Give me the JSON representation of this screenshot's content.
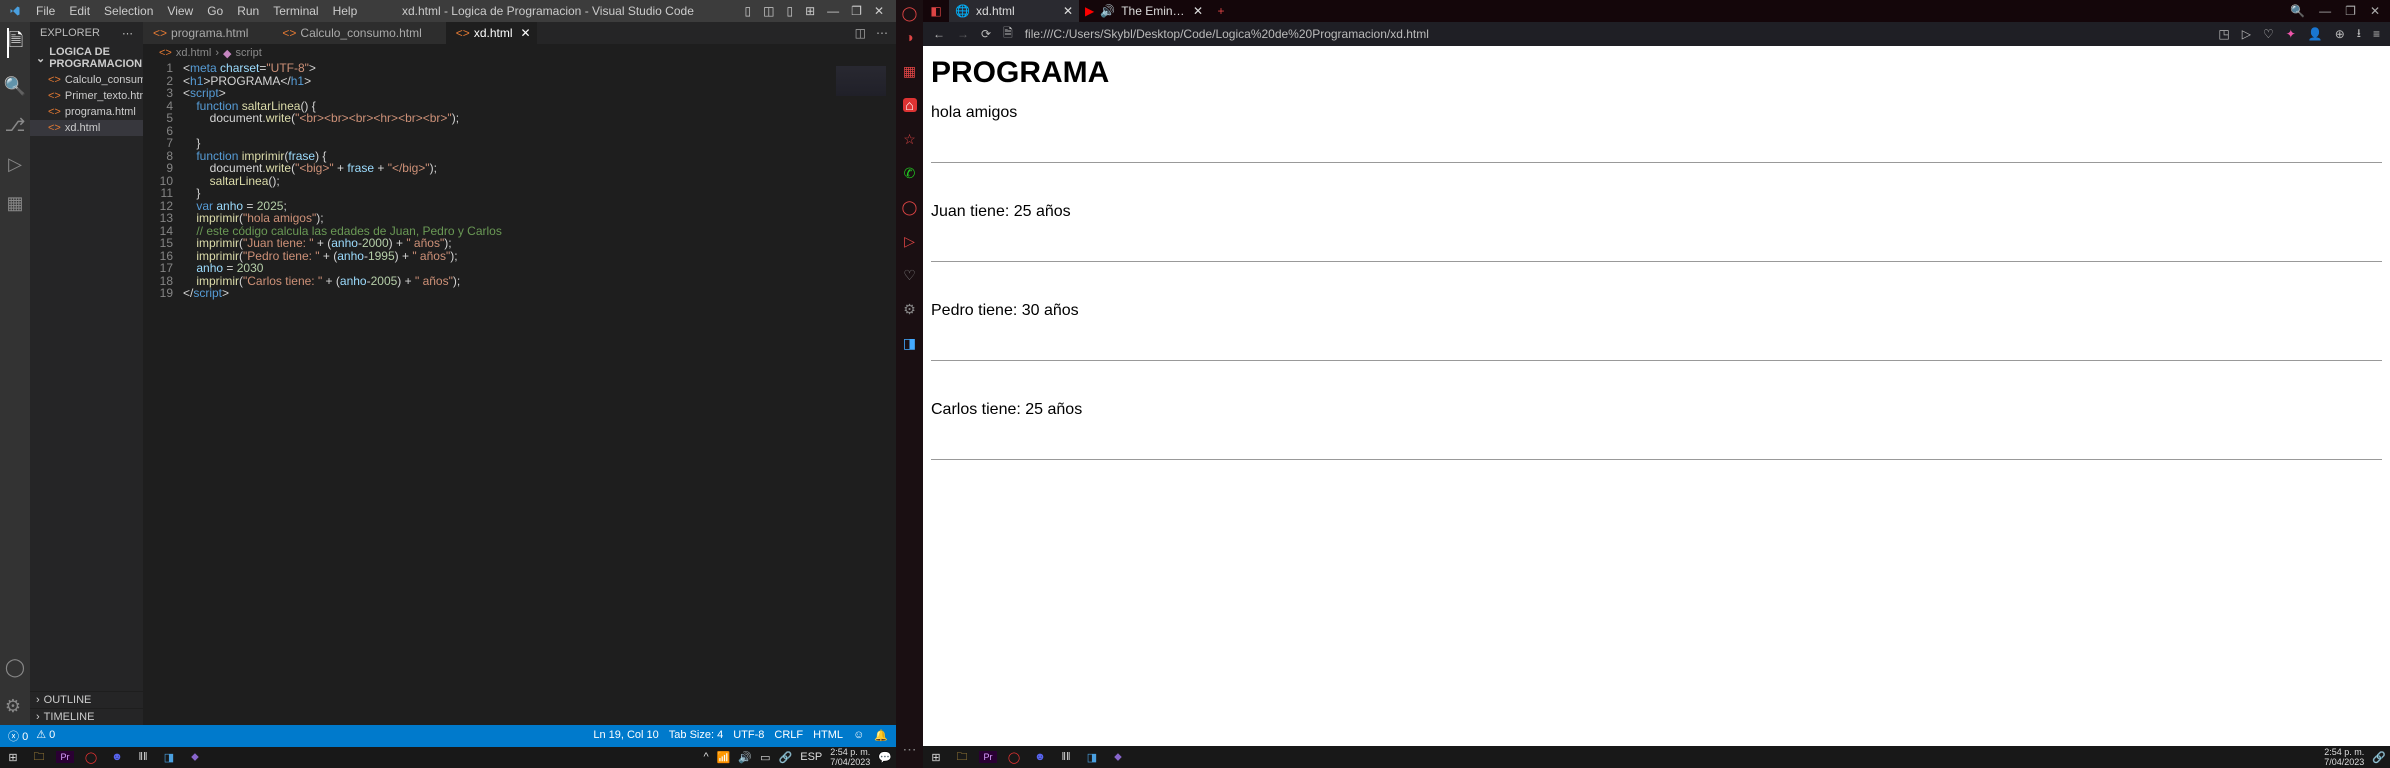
{
  "vscode": {
    "menu": [
      "File",
      "Edit",
      "Selection",
      "View",
      "Go",
      "Run",
      "Terminal",
      "Help"
    ],
    "title": "xd.html - Logica de Programacion - Visual Studio Code",
    "explorer_label": "EXPLORER",
    "folder_name": "LOGICA DE PROGRAMACION",
    "files": [
      {
        "name": "Calculo_consumo.html"
      },
      {
        "name": "Primer_texto.html"
      },
      {
        "name": "programa.html"
      },
      {
        "name": "xd.html"
      }
    ],
    "outline_label": "OUTLINE",
    "timeline_label": "TIMELINE",
    "tabs": [
      {
        "label": "programa.html",
        "active": false
      },
      {
        "label": "Calculo_consumo.html",
        "active": false
      },
      {
        "label": "xd.html",
        "active": true
      }
    ],
    "breadcrumb": [
      "xd.html",
      "script"
    ],
    "statusbar": {
      "errors": "0",
      "warnings": "0",
      "ln_col": "Ln 19, Col 10",
      "tab_size": "Tab Size: 4",
      "encoding": "UTF-8",
      "eol": "CRLF",
      "language": "HTML"
    },
    "code_lines": 19
  },
  "code": {
    "l1": {
      "a": "<",
      "b": "meta",
      "c": " charset",
      "d": "=",
      "e": "\"UTF-8\"",
      "f": ">"
    },
    "l2": {
      "a": "<",
      "b": "h1",
      "c": ">",
      "d": "PROGRAMA",
      "e": "</",
      "f": "h1",
      "g": ">"
    },
    "l3": {
      "a": "<",
      "b": "script",
      "c": ">"
    },
    "l4": {
      "a": "    ",
      "b": "function",
      "c": " ",
      "d": "saltarLinea",
      "e": "() {"
    },
    "l5": {
      "a": "        document.",
      "b": "write",
      "c": "(",
      "d": "\"<br><br><br><hr><br><br>\"",
      "e": ");"
    },
    "l6": {
      "a": ""
    },
    "l7": {
      "a": "    }"
    },
    "l8": {
      "a": "    ",
      "b": "function",
      "c": " ",
      "d": "imprimir",
      "e": "(",
      "f": "frase",
      "g": ") {"
    },
    "l9": {
      "a": "        document.",
      "b": "write",
      "c": "(",
      "d": "\"<big>\"",
      "e": " + ",
      "f": "frase",
      "g": " + ",
      "h": "\"</big>\"",
      "i": ");"
    },
    "l10": {
      "a": "        ",
      "b": "saltarLinea",
      "c": "();"
    },
    "l11": {
      "a": "    }"
    },
    "l12": {
      "a": "    ",
      "b": "var",
      "c": " ",
      "d": "anho",
      "e": " = ",
      "f": "2025",
      "g": ";"
    },
    "l13": {
      "a": "    ",
      "b": "imprimir",
      "c": "(",
      "d": "\"hola amigos\"",
      "e": ");"
    },
    "l14": {
      "a": "    ",
      "b": "// este código calcula las edades de Juan, Pedro y Carlos"
    },
    "l15": {
      "a": "    ",
      "b": "imprimir",
      "c": "(",
      "d": "\"Juan tiene: \"",
      "e": " + (",
      "f": "anho",
      "g": "-",
      "h": "2000",
      "i": ") + ",
      "j": "\" años\"",
      "k": ");"
    },
    "l16": {
      "a": "    ",
      "b": "imprimir",
      "c": "(",
      "d": "\"Pedro tiene: \"",
      "e": " + (",
      "f": "anho",
      "g": "-",
      "h": "1995",
      "i": ") + ",
      "j": "\" años\"",
      "k": ");"
    },
    "l17": {
      "a": "    ",
      "b": "anho",
      "c": " = ",
      "d": "2030"
    },
    "l18": {
      "a": "    ",
      "b": "imprimir",
      "c": "(",
      "d": "\"Carlos tiene: \"",
      "e": " + (",
      "f": "anho",
      "g": "-",
      "h": "2005",
      "i": ") + ",
      "j": "\" años\"",
      "k": ");"
    },
    "l19": {
      "a": "</",
      "b": "script",
      "c": ">"
    }
  },
  "opera": {
    "tabs": [
      {
        "label": "xd.html"
      },
      {
        "label": "The Eminence in Shad"
      }
    ],
    "url": "file:///C:/Users/Skybl/Desktop/Code/Logica%20de%20Programacion/xd.html",
    "page_title": "PROGRAMA",
    "output_lines": [
      "hola amigos",
      "Juan tiene: 25 años",
      "Pedro tiene: 30 años",
      "Carlos tiene: 25 años"
    ]
  },
  "taskbar": {
    "lang": "ESP",
    "time": "2:54 p. m.",
    "date": "7/04/2023"
  }
}
